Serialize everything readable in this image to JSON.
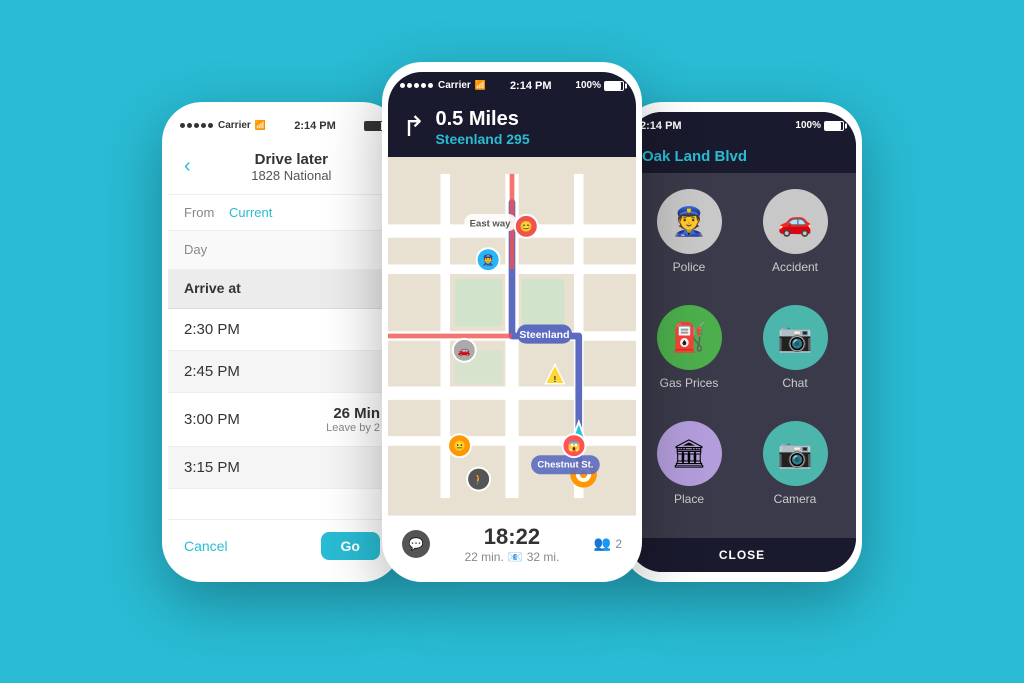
{
  "background_color": "#29bcd4",
  "left_phone": {
    "status_bar": {
      "carrier": "Carrier",
      "wifi": "▲",
      "time": "2:14 PM"
    },
    "header": {
      "title": "Drive later",
      "subtitle": "1828 National",
      "back_label": "‹"
    },
    "form": {
      "from_label": "From",
      "from_value": "Current",
      "day_label": "Day"
    },
    "arrive_at_label": "Arrive at",
    "time_rows": [
      {
        "time": "2:30 PM",
        "duration": "",
        "leave_by": ""
      },
      {
        "time": "2:45 PM",
        "duration": "",
        "leave_by": ""
      },
      {
        "time": "3:00 PM",
        "duration": "26 Min",
        "leave_by": "Leave by 2"
      },
      {
        "time": "3:15 PM",
        "duration": "",
        "leave_by": ""
      }
    ],
    "footer": {
      "cancel_label": "Cancel",
      "go_label": "Go"
    }
  },
  "center_phone": {
    "status_bar": {
      "carrier": "Carrier",
      "wifi": "▲",
      "time": "2:14 PM",
      "battery": "100%"
    },
    "navigation": {
      "distance": "0.5 Miles",
      "street": "Steenland 295",
      "turn_arrow": "↱"
    },
    "map": {
      "label1": "East way",
      "label2": "Steenland",
      "label3": "Chestnut St."
    },
    "bottom_bar": {
      "eta": "18:22",
      "minutes": "22 min.",
      "miles": "32 mi.",
      "users": "2"
    }
  },
  "right_phone": {
    "status_bar": {
      "time": "2:14 PM",
      "battery": "100%"
    },
    "header": {
      "street": "Oak Land Blvd"
    },
    "report_items": [
      {
        "id": "police",
        "label": "Police",
        "icon": "👮",
        "color_class": "icon-gray"
      },
      {
        "id": "accident",
        "label": "Accident",
        "icon": "🚗",
        "color_class": "icon-gray"
      },
      {
        "id": "gas",
        "label": "Gas Prices",
        "icon": "⛽",
        "color_class": "icon-green"
      },
      {
        "id": "chat",
        "label": "Chat",
        "icon": "📷",
        "color_class": "icon-teal"
      },
      {
        "id": "place",
        "label": "Place",
        "icon": "🏛",
        "color_class": "icon-purple"
      },
      {
        "id": "camera",
        "label": "Camera",
        "icon": "📷",
        "color_class": "icon-teal"
      }
    ],
    "footer": {
      "close_label": "CLOSE"
    }
  }
}
